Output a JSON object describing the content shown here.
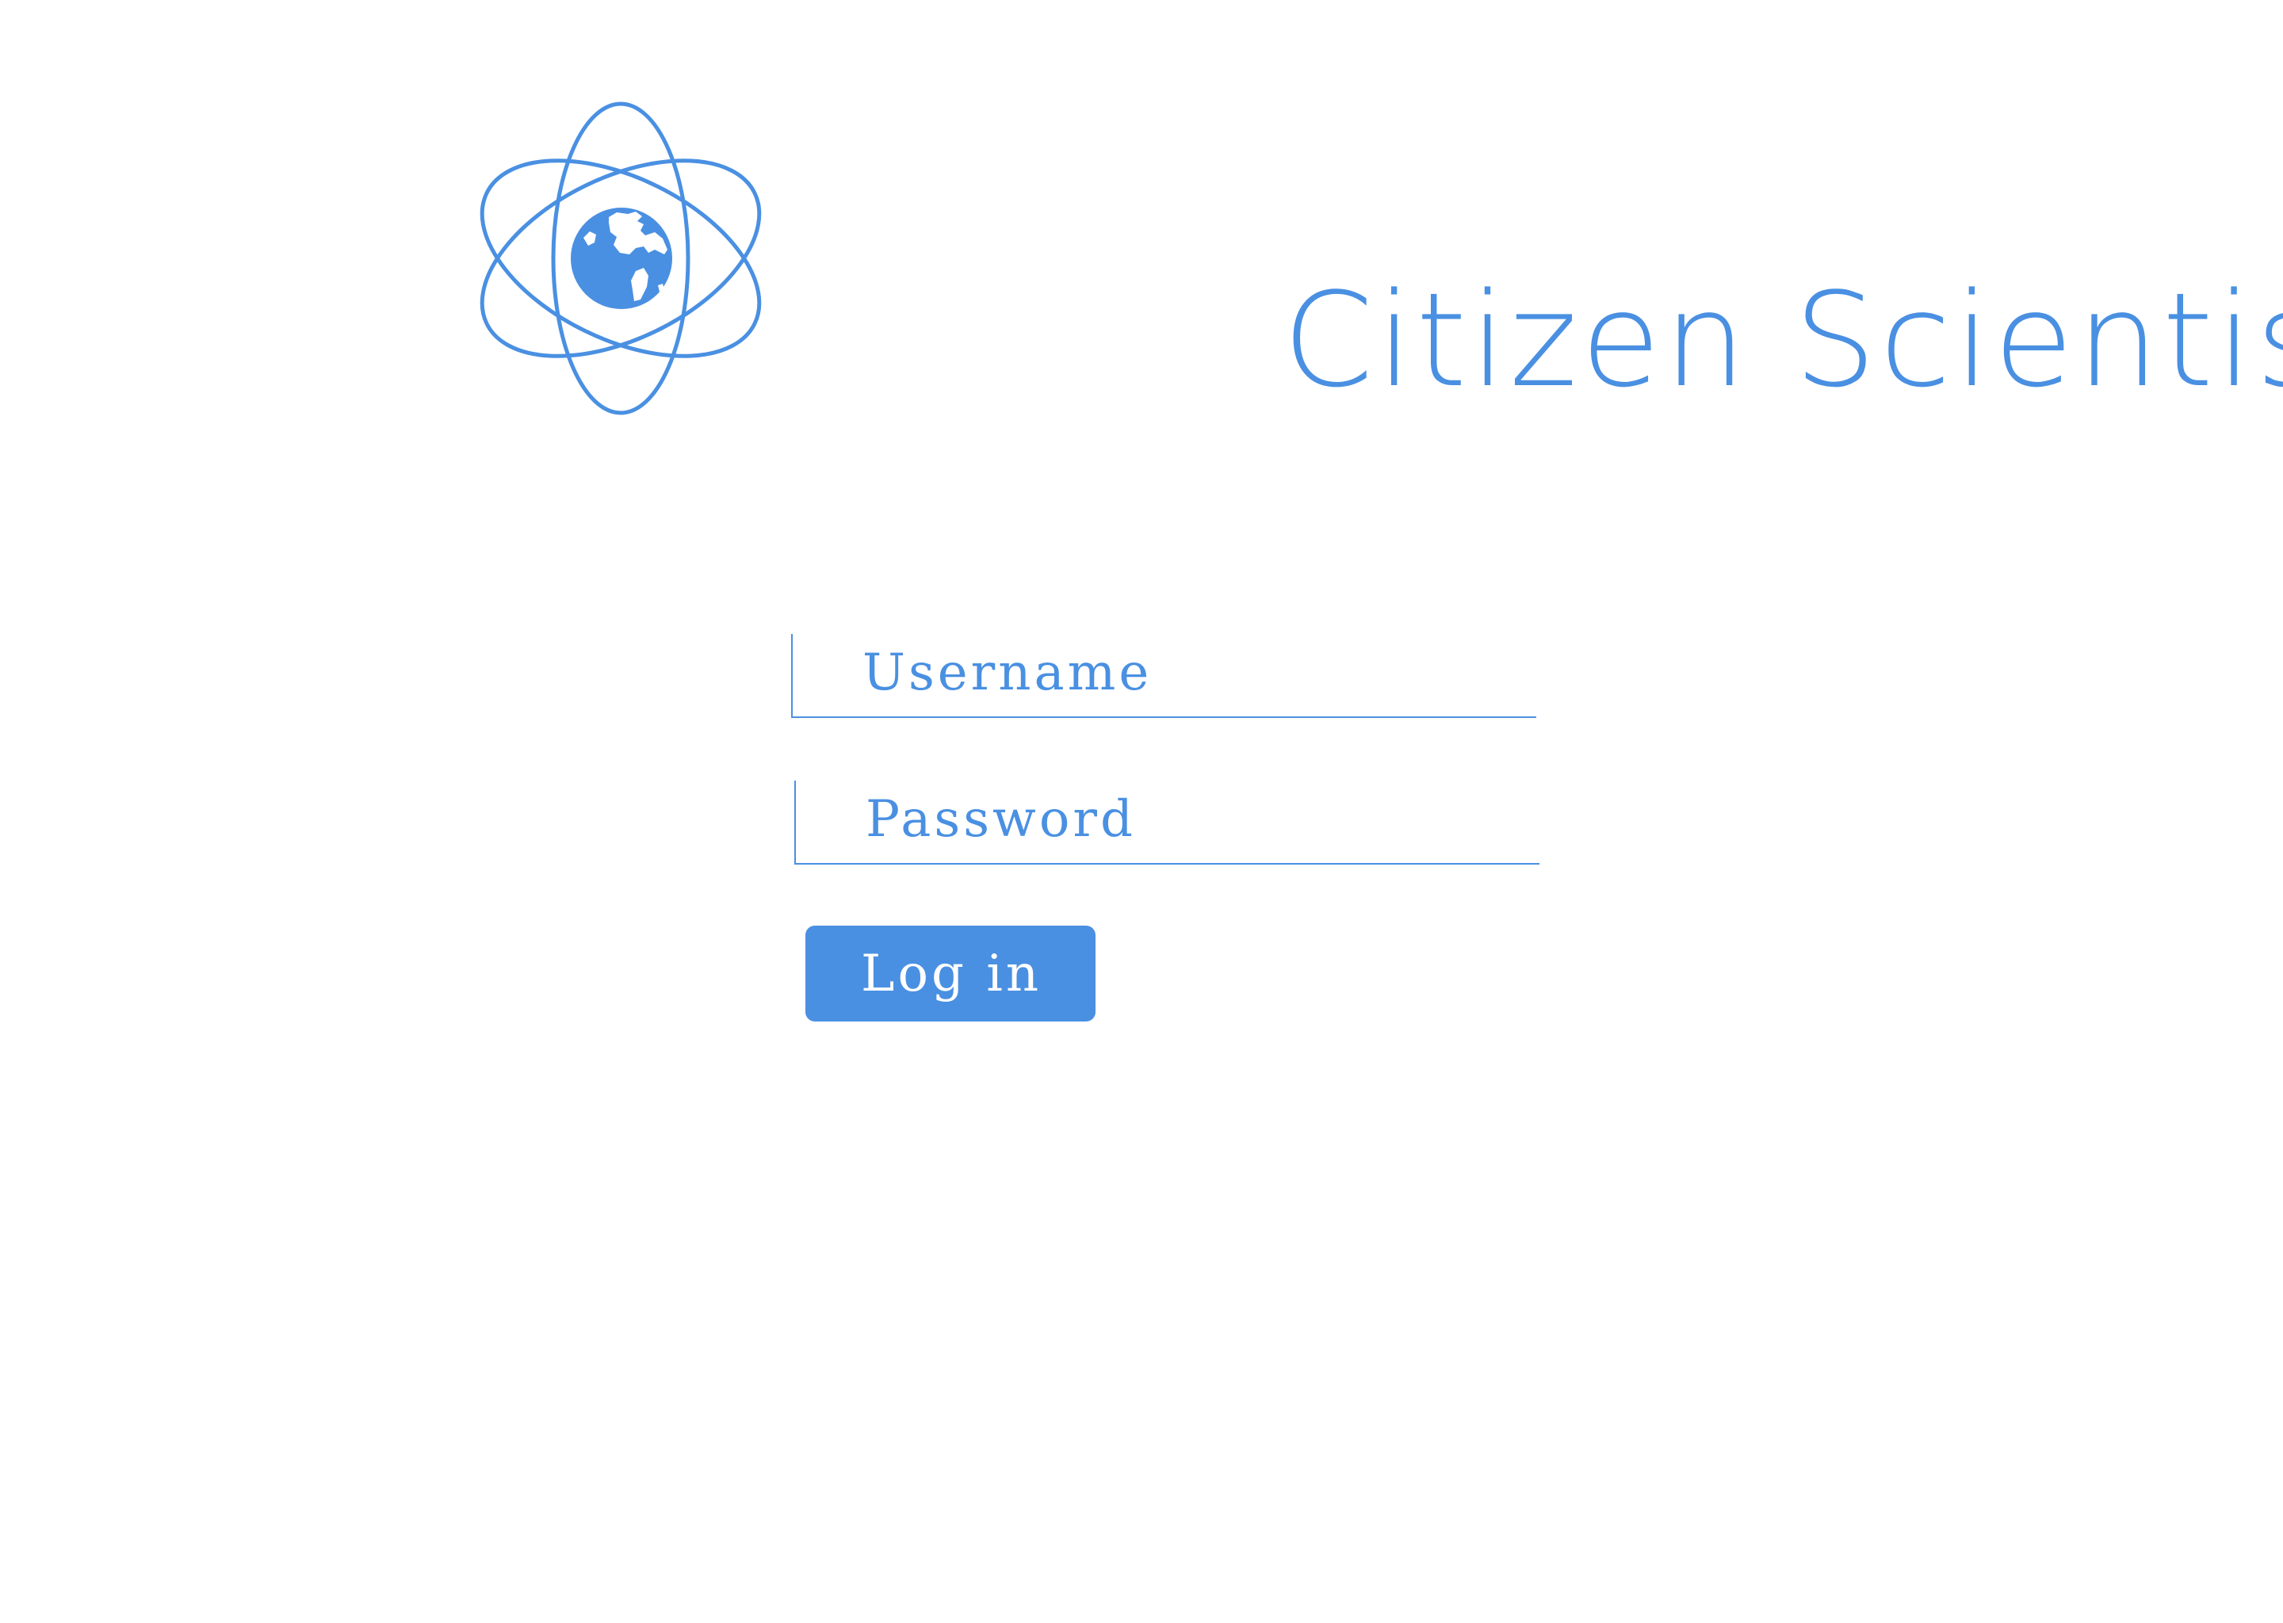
{
  "brand": {
    "name": "Citizen Scientist",
    "logo_icon": "atom-globe-icon",
    "accent_color": "#4a90e2"
  },
  "login_form": {
    "username_placeholder": "Username",
    "username_value": "",
    "password_placeholder": "Password",
    "password_value": "",
    "submit_label": "Log in"
  }
}
